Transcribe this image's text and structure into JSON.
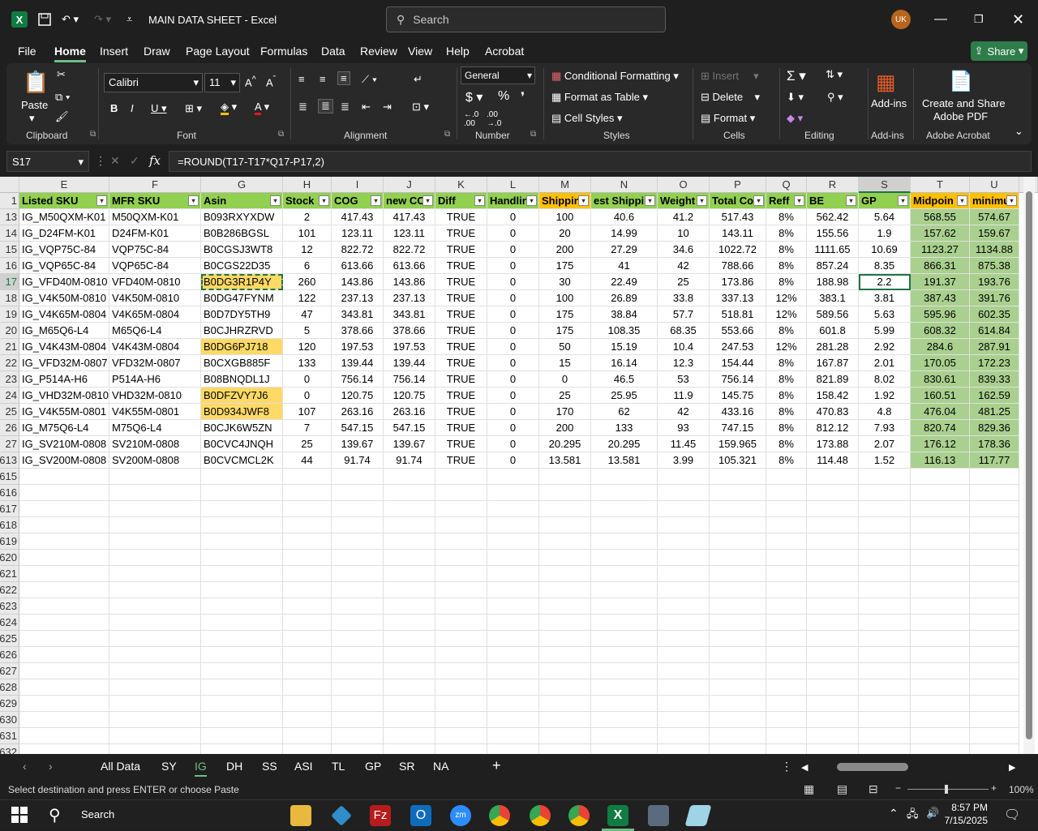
{
  "window": {
    "title": "MAIN DATA SHEET  -  Excel",
    "search_placeholder": "Search",
    "avatar_initials": "UK"
  },
  "menu": {
    "items": [
      "File",
      "Home",
      "Insert",
      "Draw",
      "Page Layout",
      "Formulas",
      "Data",
      "Review",
      "View",
      "Help",
      "Acrobat"
    ],
    "active": "Home",
    "share_label": "Share"
  },
  "ribbon": {
    "clipboard": {
      "paste": "Paste",
      "label": "Clipboard"
    },
    "font": {
      "name": "Calibri",
      "size": "11",
      "label": "Font"
    },
    "alignment": {
      "label": "Alignment"
    },
    "number": {
      "format": "General",
      "label": "Number"
    },
    "styles": {
      "conditional": "Conditional Formatting",
      "table": "Format as Table",
      "cell": "Cell Styles",
      "label": "Styles"
    },
    "cells": {
      "insert": "Insert",
      "delete": "Delete",
      "format": "Format",
      "label": "Cells"
    },
    "editing": {
      "label": "Editing"
    },
    "addins": {
      "btn": "Add-ins",
      "label": "Add-ins"
    },
    "acrobat": {
      "btn1": "Create and Share",
      "btn2": "Adobe PDF",
      "label": "Adobe Acrobat"
    }
  },
  "formula_bar": {
    "name_box": "S17",
    "formula": "=ROUND(T17-T17*Q17-P17,2)"
  },
  "columns": [
    "E",
    "F",
    "G",
    "H",
    "I",
    "J",
    "K",
    "L",
    "M",
    "N",
    "O",
    "P",
    "Q",
    "R",
    "S",
    "T",
    "U"
  ],
  "header_row": {
    "row_num": "1",
    "cells": [
      "Listed SKU",
      "MFR SKU",
      "Asin",
      "Stock",
      "COG",
      "new CC",
      "Diff",
      "Handlin",
      "Shippin",
      "est Shippi",
      "Weight",
      "Total Co",
      "Reff",
      "BE",
      "GP",
      "Midpoin",
      "minimu"
    ]
  },
  "rows": [
    {
      "num": "13",
      "cells": [
        "IG_M50QXM-K01",
        "M50QXM-K01",
        "B093RXYXDW",
        "2",
        "417.43",
        "417.43",
        "TRUE",
        "0",
        "100",
        "40.6",
        "41.2",
        "517.43",
        "8%",
        "562.42",
        "5.64",
        "568.55",
        "574.67"
      ]
    },
    {
      "num": "14",
      "cells": [
        "IG_D24FM-K01",
        "D24FM-K01",
        "B0B286BGSL",
        "101",
        "123.11",
        "123.11",
        "TRUE",
        "0",
        "20",
        "14.99",
        "10",
        "143.11",
        "8%",
        "155.56",
        "1.9",
        "157.62",
        "159.67"
      ]
    },
    {
      "num": "15",
      "cells": [
        "IG_VQP75C-84",
        "VQP75C-84",
        "B0CGSJ3WT8",
        "12",
        "822.72",
        "822.72",
        "TRUE",
        "0",
        "200",
        "27.29",
        "34.6",
        "1022.72",
        "8%",
        "1111.65",
        "10.69",
        "1123.27",
        "1134.88"
      ]
    },
    {
      "num": "16",
      "cells": [
        "IG_VQP65C-84",
        "VQP65C-84",
        "B0CGS22D35",
        "6",
        "613.66",
        "613.66",
        "TRUE",
        "0",
        "175",
        "41",
        "42",
        "788.66",
        "8%",
        "857.24",
        "8.35",
        "866.31",
        "875.38"
      ]
    },
    {
      "num": "17",
      "cells": [
        "IG_VFD40M-0810",
        "VFD40M-0810",
        "B0DG3R1P4Y",
        "260",
        "143.86",
        "143.86",
        "TRUE",
        "0",
        "30",
        "22.49",
        "25",
        "173.86",
        "8%",
        "188.98",
        "2.2",
        "191.37",
        "193.76"
      ]
    },
    {
      "num": "18",
      "cells": [
        "IG_V4K50M-0810",
        "V4K50M-0810",
        "B0DG47FYNM",
        "122",
        "237.13",
        "237.13",
        "TRUE",
        "0",
        "100",
        "26.89",
        "33.8",
        "337.13",
        "12%",
        "383.1",
        "3.81",
        "387.43",
        "391.76"
      ]
    },
    {
      "num": "19",
      "cells": [
        "IG_V4K65M-0804",
        "V4K65M-0804",
        "B0D7DY5TH9",
        "47",
        "343.81",
        "343.81",
        "TRUE",
        "0",
        "175",
        "38.84",
        "57.7",
        "518.81",
        "12%",
        "589.56",
        "5.63",
        "595.96",
        "602.35"
      ]
    },
    {
      "num": "20",
      "cells": [
        "IG_M65Q6-L4",
        "M65Q6-L4",
        "B0CJHRZRVD",
        "5",
        "378.66",
        "378.66",
        "TRUE",
        "0",
        "175",
        "108.35",
        "68.35",
        "553.66",
        "8%",
        "601.8",
        "5.99",
        "608.32",
        "614.84"
      ]
    },
    {
      "num": "21",
      "cells": [
        "IG_V4K43M-0804",
        "V4K43M-0804",
        "B0DG6PJ718",
        "120",
        "197.53",
        "197.53",
        "TRUE",
        "0",
        "50",
        "15.19",
        "10.4",
        "247.53",
        "12%",
        "281.28",
        "2.92",
        "284.6",
        "287.91"
      ]
    },
    {
      "num": "22",
      "cells": [
        "IG_VFD32M-0807",
        "VFD32M-0807",
        "B0CXGB885F",
        "133",
        "139.44",
        "139.44",
        "TRUE",
        "0",
        "15",
        "16.14",
        "12.3",
        "154.44",
        "8%",
        "167.87",
        "2.01",
        "170.05",
        "172.23"
      ]
    },
    {
      "num": "23",
      "cells": [
        "IG_P514A-H6",
        "P514A-H6",
        "B08BNQDL1J",
        "0",
        "756.14",
        "756.14",
        "TRUE",
        "0",
        "0",
        "46.5",
        "53",
        "756.14",
        "8%",
        "821.89",
        "8.02",
        "830.61",
        "839.33"
      ]
    },
    {
      "num": "24",
      "cells": [
        "IG_VHD32M-0810",
        "VHD32M-0810",
        "B0DFZVY7J6",
        "0",
        "120.75",
        "120.75",
        "TRUE",
        "0",
        "25",
        "25.95",
        "11.9",
        "145.75",
        "8%",
        "158.42",
        "1.92",
        "160.51",
        "162.59"
      ]
    },
    {
      "num": "25",
      "cells": [
        "IG_V4K55M-0801",
        "V4K55M-0801",
        "B0D934JWF8",
        "107",
        "263.16",
        "263.16",
        "TRUE",
        "0",
        "170",
        "62",
        "42",
        "433.16",
        "8%",
        "470.83",
        "4.8",
        "476.04",
        "481.25"
      ]
    },
    {
      "num": "26",
      "cells": [
        "IG_M75Q6-L4",
        "M75Q6-L4",
        "B0CJK6W5ZN",
        "7",
        "547.15",
        "547.15",
        "TRUE",
        "0",
        "200",
        "133",
        "93",
        "747.15",
        "8%",
        "812.12",
        "7.93",
        "820.74",
        "829.36"
      ]
    },
    {
      "num": "27",
      "cells": [
        "IG_SV210M-0808",
        "SV210M-0808",
        "B0CVC4JNQH",
        "25",
        "139.67",
        "139.67",
        "TRUE",
        "0",
        "20.295",
        "20.295",
        "11.45",
        "159.965",
        "8%",
        "173.88",
        "2.07",
        "176.12",
        "178.36"
      ]
    },
    {
      "num": "613",
      "cells": [
        "IG_SV200M-0808",
        "SV200M-0808",
        "B0CVCMCL2K",
        "44",
        "91.74",
        "91.74",
        "TRUE",
        "0",
        "13.581",
        "13.581",
        "3.99",
        "105.321",
        "8%",
        "114.48",
        "1.52",
        "116.13",
        "117.77"
      ]
    }
  ],
  "empty_rows": [
    "615",
    "616",
    "617",
    "618",
    "619",
    "620",
    "621",
    "622",
    "623",
    "624",
    "625",
    "626",
    "627",
    "628",
    "629",
    "630",
    "631",
    "632"
  ],
  "sheet_tabs": [
    "All Data",
    "SY",
    "IG",
    "DH",
    "SS",
    "ASI",
    "TL",
    "GP",
    "SR",
    "NA"
  ],
  "active_tab": "IG",
  "status": {
    "message": "Select destination and press ENTER or choose Paste",
    "zoom": "100%"
  },
  "taskbar": {
    "search": "Search",
    "time": "8:57 PM",
    "date": "7/15/2025"
  },
  "colors": {
    "green_header": "#92d050",
    "orange_header": "#ffc000",
    "green_cell": "#a9d08e",
    "orange_cell": "#ffd966",
    "accent": "#217346"
  }
}
